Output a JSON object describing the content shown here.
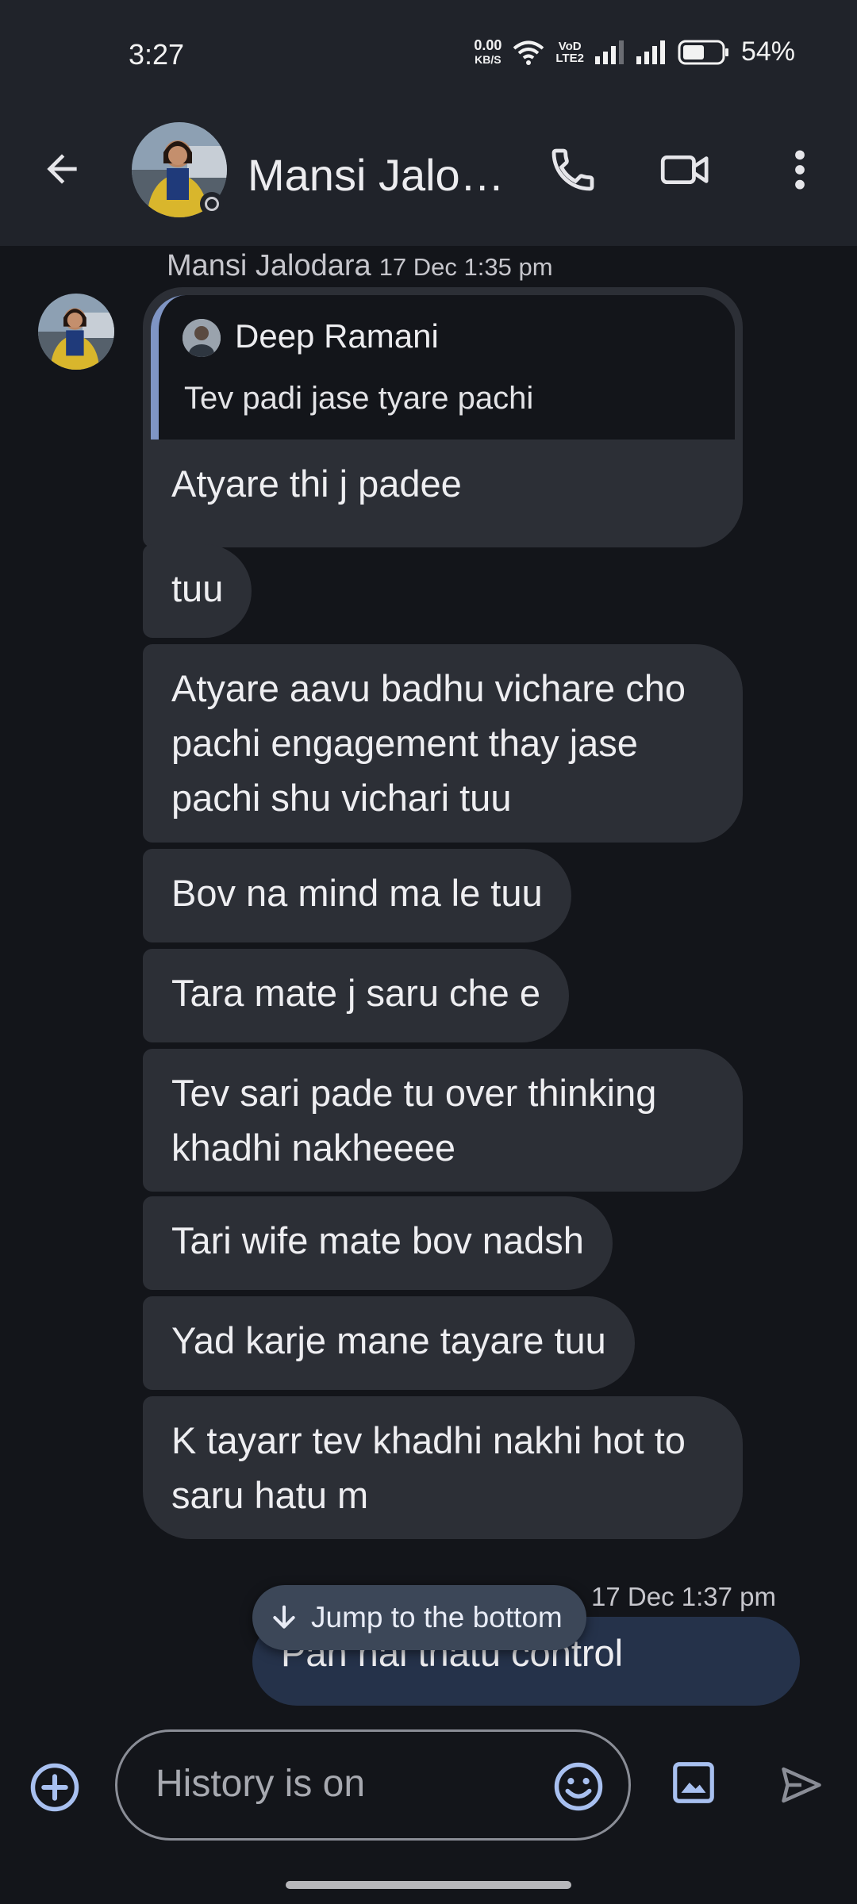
{
  "status_bar": {
    "time": "3:27",
    "net_speed_value": "0.00",
    "net_speed_unit": "KB/S",
    "volte_top": "VoD",
    "volte_bottom": "LTE2",
    "battery": "54%"
  },
  "header": {
    "contact_name": "Mansi Jalo…",
    "icons": [
      "back-arrow-icon",
      "phone-icon",
      "video-call-icon",
      "more-vert-icon"
    ]
  },
  "incoming_group": {
    "sender": "Mansi Jalodara",
    "timestamp": "17 Dec 1:35 pm",
    "reply_to": {
      "name": "Deep Ramani",
      "text": "Tev padi jase tyare pachi"
    },
    "messages": [
      "Atyare thi j padee",
      "tuu",
      "Atyare aavu badhu vichare cho pachi engagement thay jase pachi shu vichari tuu",
      "Bov na mind ma le tuu",
      "Tara mate j saru che e",
      "Tev sari pade tu over thinking khadhi nakheeee",
      "Tari wife mate bov nadsh",
      "Yad karje mane tayare tuu",
      "K tayarr tev khadhi nakhi hot to saru hatu m"
    ]
  },
  "outgoing": {
    "timestamp": "17 Dec 1:37 pm",
    "text": "Pan nai thatu control"
  },
  "jump_button": {
    "label": "Jump to the bottom"
  },
  "composer": {
    "placeholder": "History is on"
  },
  "colors": {
    "background": "#13151a",
    "bar": "#20232a",
    "incoming_bubble": "#2c2f36",
    "outgoing_bubble": "#25324a",
    "accent": "#a8c0f0"
  }
}
